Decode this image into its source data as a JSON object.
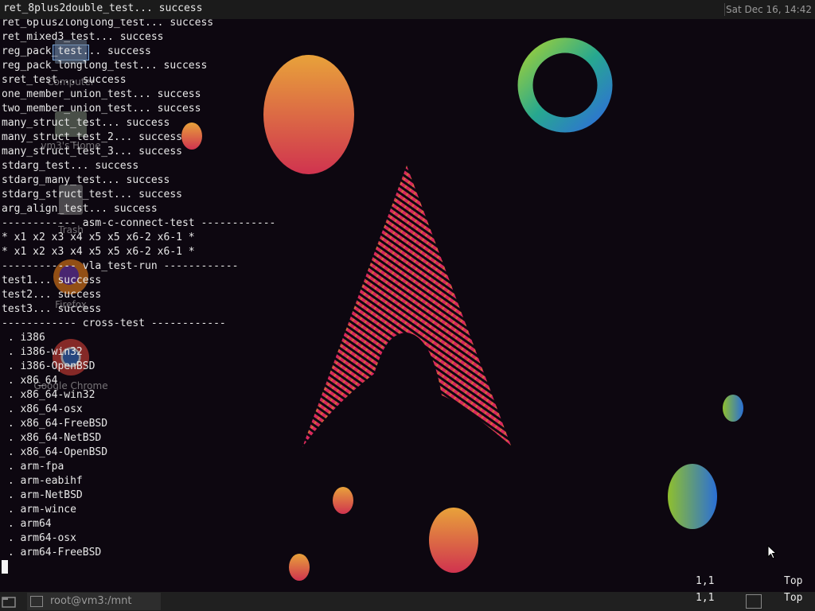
{
  "top_panel": {
    "first_line": "ret_8plus2double_test... success",
    "clock": "Sat Dec 16, 14:42"
  },
  "desktop_icons": [
    {
      "name": "computer",
      "label": "Computer"
    },
    {
      "name": "home",
      "label": "vm3's Home"
    },
    {
      "name": "trash",
      "label": "Trash"
    },
    {
      "name": "firefox",
      "label": "Firefox"
    },
    {
      "name": "chrome",
      "label": "Google Chrome"
    }
  ],
  "terminal_lines": [
    "ret_6plus2longlong_test... success",
    "ret_mixed3_test... success",
    "reg_pack_test... success",
    "reg_pack_longlong_test... success",
    "sret_test... success",
    "one_member_union_test... success",
    "two_member_union_test... success",
    "many_struct_test... success",
    "many_struct_test_2... success",
    "many_struct_test_3... success",
    "stdarg_test... success",
    "stdarg_many_test... success",
    "stdarg_struct_test... success",
    "arg_align_test... success",
    "------------ asm-c-connect-test ------------",
    "* x1 x2 x3 x4 x5 x5 x6-2 x6-1 *",
    "* x1 x2 x3 x4 x5 x5 x6-2 x6-1 *",
    "------------ vla_test-run ------------",
    "test1... success",
    "test2... success",
    "test3... success",
    "------------ cross-test ------------",
    " . i386",
    " . i386-win32",
    " . i386-OpenBSD",
    " . x86_64",
    " . x86_64-win32",
    " . x86_64-osx",
    " . x86_64-FreeBSD",
    " . x86_64-NetBSD",
    " . x86_64-OpenBSD",
    " . arm-fpa",
    " . arm-eabihf",
    " . arm-NetBSD",
    " . arm-wince",
    " . arm64",
    " . arm64-osx",
    " . arm64-FreeBSD"
  ],
  "ruler": {
    "position": "1,1",
    "scroll": "Top"
  },
  "taskbar": {
    "window_title": "root@vm3:/mnt",
    "ruler_position": "1,1",
    "ruler_scroll": "Top"
  }
}
